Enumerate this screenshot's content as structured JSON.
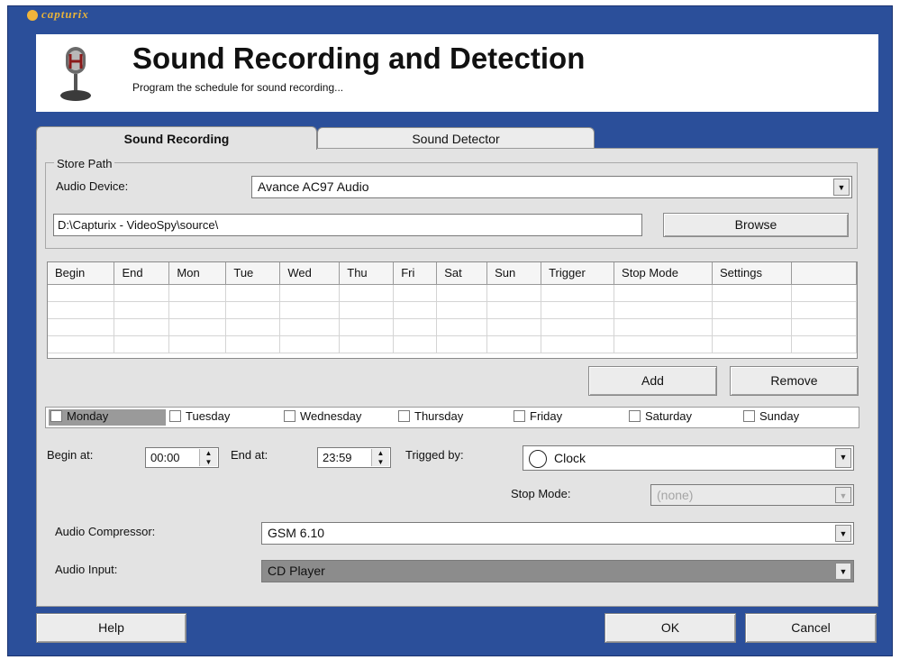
{
  "brand": "capturix",
  "header": {
    "title": "Sound Recording and Detection",
    "subtitle": "Program the schedule for sound recording..."
  },
  "tabs": [
    {
      "label": "Sound Recording",
      "active": true
    },
    {
      "label": "Sound Detector",
      "active": false
    }
  ],
  "store_path": {
    "legend": "Store Path",
    "audio_device_label": "Audio Device:",
    "audio_device_value": "Avance AC97 Audio",
    "path_value": "D:\\Capturix - VideoSpy\\source\\",
    "browse_label": "Browse"
  },
  "schedule_table": {
    "columns": [
      "Begin",
      "End",
      "Mon",
      "Tue",
      "Wed",
      "Thu",
      "Fri",
      "Sat",
      "Sun",
      "Trigger",
      "Stop Mode",
      "Settings",
      ""
    ],
    "rows": []
  },
  "actions": {
    "add_label": "Add",
    "remove_label": "Remove"
  },
  "days": [
    {
      "label": "Monday",
      "checked": false,
      "selected": true
    },
    {
      "label": "Tuesday",
      "checked": false
    },
    {
      "label": "Wednesday",
      "checked": false
    },
    {
      "label": "Thursday",
      "checked": false
    },
    {
      "label": "Friday",
      "checked": false
    },
    {
      "label": "Saturday",
      "checked": false
    },
    {
      "label": "Sunday",
      "checked": false
    }
  ],
  "timing": {
    "begin_label": "Begin at:",
    "begin_value": "00:00",
    "end_label": "End at:",
    "end_value": "23:59",
    "trigger_label": "Trigged by:",
    "trigger_value": "Clock",
    "trigger_icon": "clock-icon",
    "stop_mode_label": "Stop Mode:",
    "stop_mode_value": "(none)"
  },
  "audio": {
    "compressor_label": "Audio Compressor:",
    "compressor_value": "GSM 6.10",
    "input_label": "Audio Input:",
    "input_value": "CD Player"
  },
  "footer": {
    "help_label": "Help",
    "ok_label": "OK",
    "cancel_label": "Cancel"
  },
  "colors": {
    "frame": "#2b4f9a",
    "panel": "#e3e3e3",
    "selected": "#9a9a9a"
  }
}
